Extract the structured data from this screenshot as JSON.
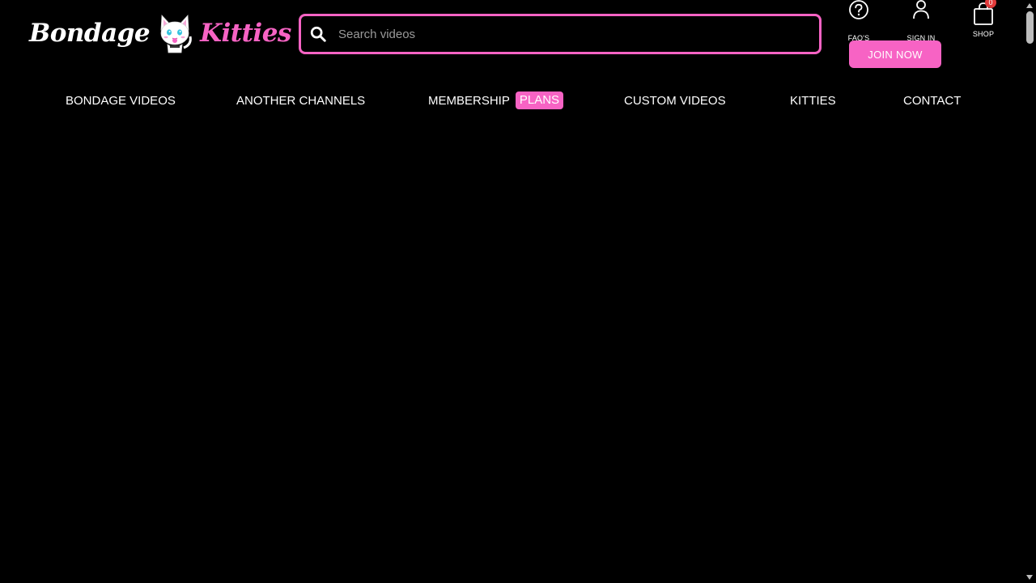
{
  "header": {
    "logo": {
      "word1": "Bondage",
      "word2": "Kitties",
      "mascot_icon": "kitty-mascot-icon"
    },
    "search": {
      "placeholder": "Search videos",
      "value": "",
      "icon": "search-icon"
    },
    "icons": {
      "faq": {
        "label": "FAQ'S",
        "icon": "question-circle-icon"
      },
      "signin": {
        "label": "SIGN IN",
        "icon": "user-icon"
      },
      "shop": {
        "label": "SHOP",
        "icon": "shopping-bag-icon",
        "count": "0"
      }
    },
    "join_button": "JOIN NOW"
  },
  "nav": {
    "items": [
      {
        "label": "BONDAGE VIDEOS"
      },
      {
        "label": "ANOTHER CHANNELS"
      },
      {
        "label": "MEMBERSHIP",
        "badge": "PLANS"
      },
      {
        "label": "CUSTOM VIDEOS"
      },
      {
        "label": "KITTIES"
      },
      {
        "label": "CONTACT"
      }
    ]
  },
  "colors": {
    "accent": "#f763c4",
    "background": "#000000",
    "text": "#ffffff",
    "badge": "#e23b3b"
  }
}
